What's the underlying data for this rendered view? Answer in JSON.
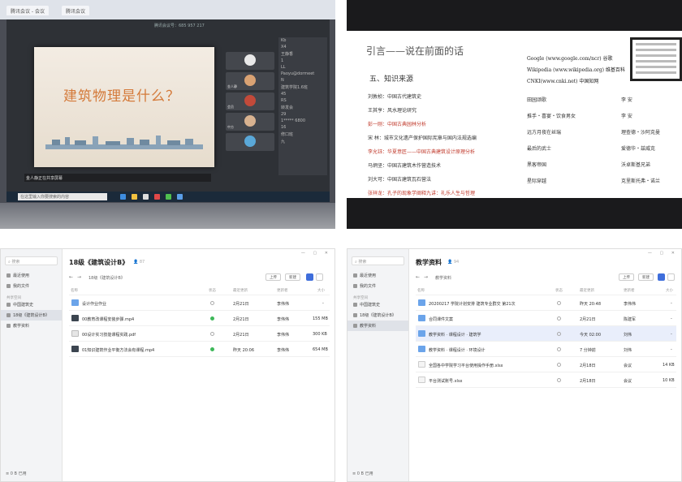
{
  "panel1": {
    "tabs": [
      "腾讯会议 - 会议",
      "腾讯会议"
    ],
    "meeting_id": "腾讯会议号：685 957 217",
    "slide_title": "建筑物理是什么？",
    "video_labels": [
      "",
      "金人静",
      "会员",
      "中方",
      ""
    ],
    "members": [
      "Kb",
      "X4",
      "王静香",
      "1",
      "LL",
      "Paoyu@dormeet",
      "N",
      "建筑学院1.6班",
      "45",
      "RS",
      "转发会",
      "29",
      "1***** 6800",
      "16",
      "修口班",
      "九"
    ],
    "bottom_text": "金人静正在共享屏幕",
    "search_text": "在这里输入你要搜索的内容"
  },
  "panel2": {
    "title": "引言——说在前面的话",
    "section": "五、知识来源",
    "authors": [
      {
        "text": "刘敦桢：中国古代建筑史",
        "red": false
      },
      {
        "text": "王其亨：风水理论研究",
        "red": false
      },
      {
        "text": "彭一刚：中国古典园林分析",
        "red": true
      },
      {
        "text": "宋 林：城市文化遗产保护国际宪章与国内法规选编",
        "red": false
      },
      {
        "text": "李允钰：华夏意匠——中国古典建筑设计原理分析",
        "red": true
      },
      {
        "text": "马炳坚：中国古建筑木作营造技术",
        "red": false
      },
      {
        "text": "刘大可：中国古建筑瓦石营法",
        "red": false
      },
      {
        "text": "张祥龙：孔子的现象学阐释九讲：礼乐人生与哲理",
        "red": true
      }
    ],
    "web_sources": [
      "Google (www.google.com/ncr) 谷歌",
      "Wikipedia (www.wikipedia.org) 维基百科",
      "CNKI(www.cnki.net) 中国知网"
    ],
    "books": [
      {
        "title": "田园颂歌",
        "author": "李 安"
      },
      {
        "title": "推手・喜宴・饮食男女",
        "author": "李 安"
      },
      {
        "title": "远方月夜在丝瑞",
        "author": "理查德・沙阿克曼"
      },
      {
        "title": "最后的武士",
        "author": "爱德华・兹威克"
      },
      {
        "title": "黑客帝国",
        "author": "沃卓斯基兄弟"
      },
      {
        "title": "星际穿越",
        "author": "克里斯托弗・诺兰"
      }
    ]
  },
  "panel3": {
    "sidebar": {
      "search": "搜索",
      "items": [
        {
          "label": "最近使用",
          "selected": false
        },
        {
          "label": "我的文件",
          "selected": false
        }
      ],
      "shared_head": "共享空间",
      "shared": [
        {
          "label": "中国建筑史",
          "selected": false
        },
        {
          "label": "18级《建筑设计B》",
          "selected": true
        },
        {
          "label": "教学资料",
          "selected": false
        }
      ],
      "storage": "0 B 已用"
    },
    "title": "18级《建筑设计B》",
    "count": "87",
    "crumb": "18级《建筑设计B》",
    "buttons": [
      "上传",
      "新建"
    ],
    "columns": [
      "名称",
      "状态",
      "最近更新",
      "更新者",
      "大小"
    ],
    "rows": [
      {
        "icon": "folder",
        "name": "设计作业作业",
        "status": "pending",
        "time": "2月21日",
        "user": "李伟伟",
        "size": "-"
      },
      {
        "icon": "video",
        "name": "00教育改课程安装步骤.mp4",
        "status": "ok",
        "time": "2月21日",
        "user": "李伟伟",
        "size": "155 MB"
      },
      {
        "icon": "pdf",
        "name": "00设计实习技能课程实践.pdf",
        "status": "pending",
        "time": "2月21日",
        "user": "李伟伟",
        "size": "300 KB"
      },
      {
        "icon": "video",
        "name": "01知识建筑作业平衡方法会有课程.mp4",
        "status": "ok",
        "time": "昨天 20:06",
        "user": "李伟伟",
        "size": "654 MB"
      }
    ]
  },
  "panel4": {
    "sidebar": {
      "search": "搜索",
      "items": [
        {
          "label": "最近使用",
          "selected": false
        },
        {
          "label": "我的文件",
          "selected": false
        }
      ],
      "shared_head": "共享空间",
      "shared": [
        {
          "label": "中国建筑史",
          "selected": false
        },
        {
          "label": "18级《建筑设计B》",
          "selected": false
        },
        {
          "label": "教学资料",
          "selected": true
        }
      ],
      "storage": "0 B 已用"
    },
    "title": "教学资料",
    "count": "94",
    "crumb": "教学资料",
    "buttons": [
      "上传",
      "新建"
    ],
    "columns": [
      "名称",
      "状态",
      "最近更新",
      "更新者",
      "大小"
    ],
    "rows": [
      {
        "icon": "folder",
        "name": "20200217 学院计划安排 建筑专业群交 第21次",
        "status": "pending",
        "time": "昨天 20:48",
        "user": "李伟伟",
        "size": "-"
      },
      {
        "icon": "folder",
        "name": "合同课件文案",
        "status": "pending",
        "time": "2月21日",
        "user": "陈建军",
        "size": "-"
      },
      {
        "icon": "folder",
        "name": "教学资料 · 课程设计 · 建筑学",
        "status": "pending",
        "time": "今天 02:00",
        "user": "刘伟",
        "size": "-"
      },
      {
        "icon": "folder",
        "name": "教学资料 · 课程设计 · 环境设计",
        "status": "pending",
        "time": "7 分钟前",
        "user": "刘伟",
        "size": "-"
      },
      {
        "icon": "xlsx",
        "name": "全国各中学院学习平台使用操作手册.xlsx",
        "status": "pending",
        "time": "2月18日",
        "user": "会议",
        "size": "14 KB"
      },
      {
        "icon": "xlsx",
        "name": "平台测试账号.xlsx",
        "status": "pending",
        "time": "2月18日",
        "user": "会议",
        "size": "10 KB"
      }
    ]
  }
}
